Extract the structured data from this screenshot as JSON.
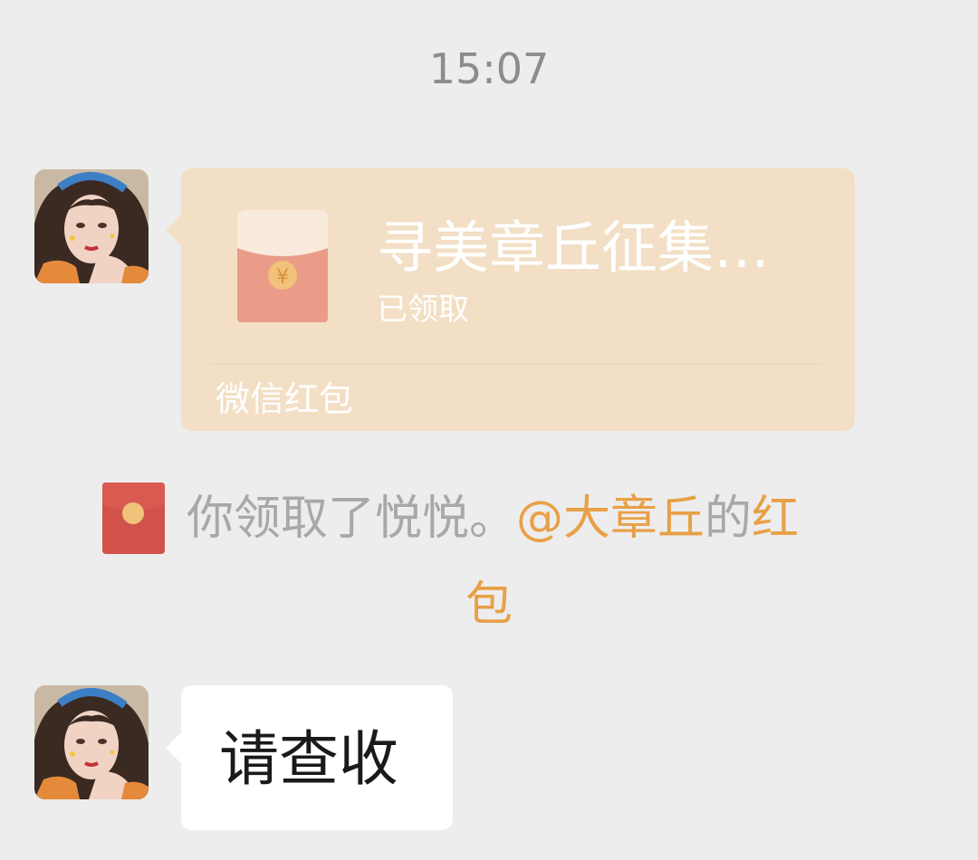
{
  "chat": {
    "timestamp": "15:07",
    "red_packet": {
      "title": "寻美章丘征集…",
      "status": "已领取",
      "footer": "微信红包",
      "icon": "red-packet-icon",
      "yuan_symbol": "¥",
      "card_color": "#f3dfc5"
    },
    "notice": {
      "prefix": "你领取了悦悦。",
      "mention": "@大章丘",
      "middle": "的",
      "link_part1": "红",
      "link_part2": "包",
      "icon": "red-packet-small-icon",
      "highlight_color": "#e8a047"
    },
    "message": {
      "text": "请查收"
    }
  }
}
